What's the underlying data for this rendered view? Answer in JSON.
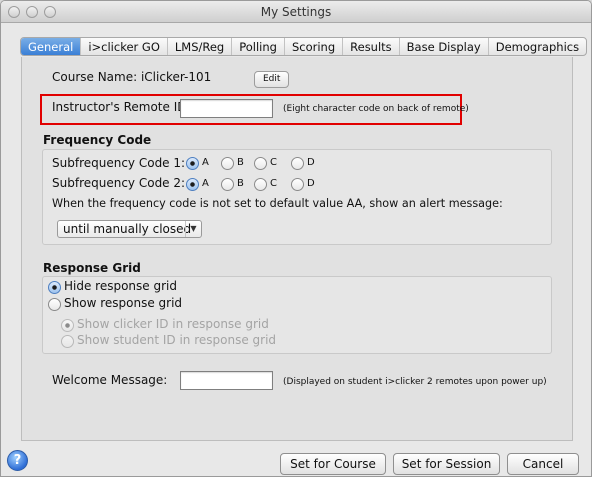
{
  "window": {
    "title": "My Settings"
  },
  "tabs": [
    {
      "label": "General",
      "active": true
    },
    {
      "label": "i>clicker GO",
      "active": false
    },
    {
      "label": "LMS/Reg",
      "active": false
    },
    {
      "label": "Polling",
      "active": false
    },
    {
      "label": "Scoring",
      "active": false
    },
    {
      "label": "Results",
      "active": false
    },
    {
      "label": "Base Display",
      "active": false
    },
    {
      "label": "Demographics",
      "active": false
    }
  ],
  "general": {
    "course_name_label": "Course Name: iClicker-101",
    "edit_button": "Edit",
    "remote_id_label": "Instructor's Remote ID:",
    "remote_id_value": "",
    "remote_id_note": "(Eight character code on back of remote)"
  },
  "frequency": {
    "header": "Frequency Code",
    "sub1_label": "Subfrequency Code 1:",
    "sub2_label": "Subfrequency Code 2:",
    "options": [
      "A",
      "B",
      "C",
      "D"
    ],
    "sub1_selected": "A",
    "sub2_selected": "A",
    "alert_text": "When the frequency code is not set to default value AA, show an alert message:",
    "alert_select_value": "until manually closed"
  },
  "response_grid": {
    "header": "Response Grid",
    "hide_label": "Hide response grid",
    "show_label": "Show response grid",
    "show_clicker_id": "Show clicker ID in response grid",
    "show_student_id": "Show student ID in response grid",
    "selected": "hide"
  },
  "welcome": {
    "label": "Welcome Message:",
    "value": "",
    "note": "(Displayed on student i>clicker 2 remotes upon power up)"
  },
  "buttons": {
    "help": "?",
    "set_for_course": "Set for Course",
    "set_for_session": "Set for Session",
    "cancel": "Cancel"
  },
  "colors": {
    "highlight_box": "#e10000",
    "active_tab": "#3a7fd6"
  }
}
